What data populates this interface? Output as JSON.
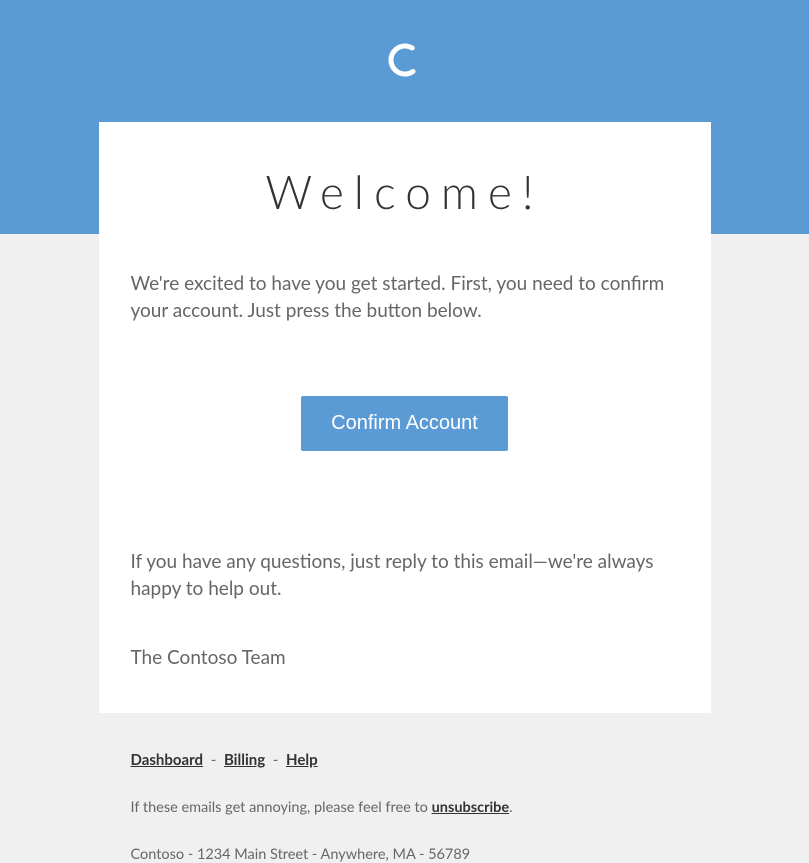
{
  "header": {
    "icon": "spinner-icon"
  },
  "card": {
    "title": "Welcome!",
    "intro": "We're excited to have you get started. First, you need to confirm your account. Just press the button below.",
    "button_label": "Confirm Account",
    "questions": "If you have any questions, just reply to this email—we're always happy to help out.",
    "signoff": "The Contoso Team"
  },
  "footer": {
    "links": {
      "dashboard": "Dashboard",
      "billing": "Billing",
      "help": "Help",
      "separator": "-"
    },
    "unsubscribe_prefix": "If these emails get annoying, please feel free to ",
    "unsubscribe_label": "unsubscribe",
    "unsubscribe_suffix": ".",
    "address": "Contoso - 1234 Main Street - Anywhere, MA - 56789"
  }
}
